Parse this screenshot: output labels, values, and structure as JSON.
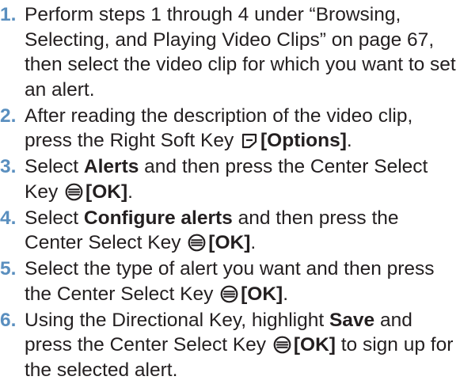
{
  "steps": [
    {
      "number": "1.",
      "text_a": "Perform steps 1 through 4 under “Browsing, Selecting, and Playing Video Clips” on page 67, then select the video clip for which you want to set an alert."
    },
    {
      "number": "2.",
      "text_a": "After reading the description of the video clip, press the Right Soft Key",
      "icon": "right-soft-key-icon",
      "bold_b": "[Options]",
      "text_c": "."
    },
    {
      "number": "3.",
      "text_a": "Select",
      "bold_a": "Alerts",
      "text_b": "and then press the Center Select Key",
      "icon": "center-select-key-icon",
      "bold_b": "[OK]",
      "text_c": "."
    },
    {
      "number": "4.",
      "text_a": "Select",
      "bold_a": "Configure alerts",
      "text_b": "and then press the Center Select Key",
      "icon": "center-select-key-icon",
      "bold_b": "[OK]",
      "text_c": "."
    },
    {
      "number": "5.",
      "text_a": "Select the type of alert you want and then press the Center Select Key",
      "icon": "center-select-key-icon",
      "bold_b": "[OK]",
      "text_c": "."
    },
    {
      "number": "6.",
      "text_a": "Using the Directional Key, highlight",
      "bold_a": "Save",
      "text_b": "and press the Center Select Key",
      "icon": "center-select-key-icon",
      "bold_b": "[OK]",
      "text_c": "to sign up for the selected alert."
    }
  ],
  "colors": {
    "step_number": "#5a8fbf",
    "body_text": "#231f20"
  }
}
